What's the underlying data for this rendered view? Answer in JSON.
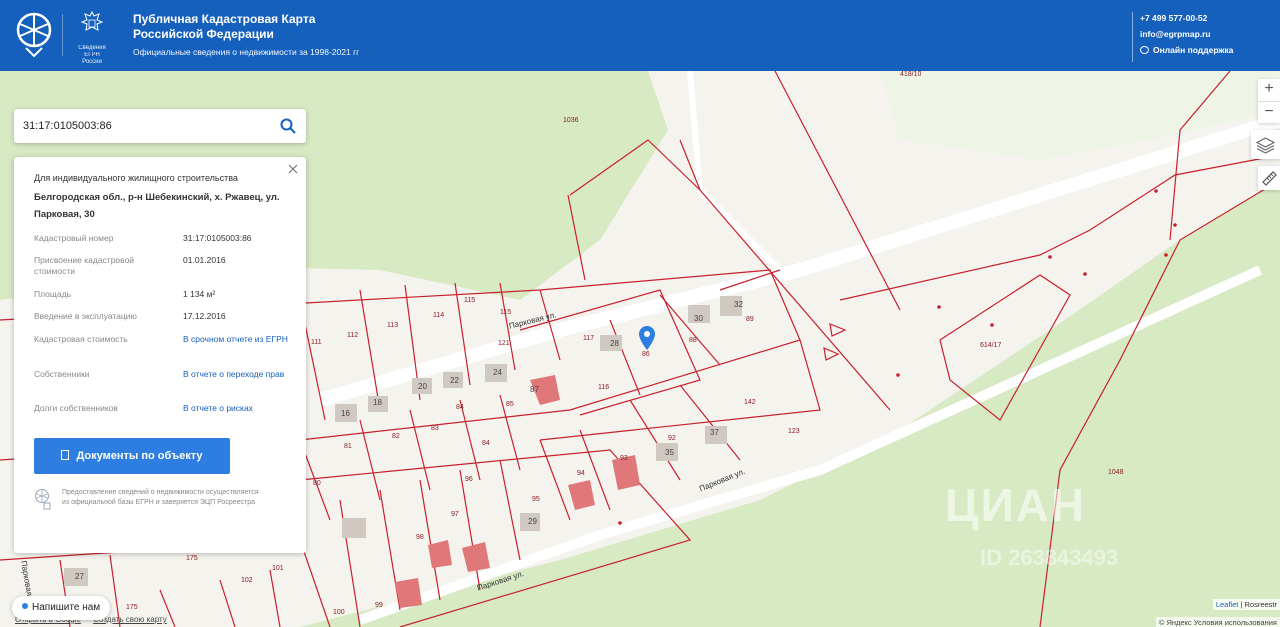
{
  "header": {
    "title_line1": "Публичная Кадастровая Карта",
    "title_line2": "Российской Федерации",
    "subtitle": "Официальные сведения о недвижимости за 1998-2021 гг",
    "emblem_line1": "Сведения",
    "emblem_line2": "ЕГРН России",
    "phone": "+7 499 577-00-52",
    "email": "info@egrpmap.ru",
    "support": "Онлайн поддержка"
  },
  "search": {
    "value": "31:17:0105003:86"
  },
  "panel": {
    "type": "Для индивидуального жилищного строительства",
    "address": "Белгородская обл., р-н Шебекинский, х. Ржавец, ул. Парковая, 30",
    "properties": [
      {
        "key": "Кадастровый номер",
        "value": "31:17:0105003:86",
        "link": false
      },
      {
        "key": "Присвоение кадастровой стоимости",
        "value": "01.01.2016",
        "link": false
      },
      {
        "key": "Площадь",
        "value": "1 134 м²",
        "link": false
      },
      {
        "key": "Введение в эксплуатацию",
        "value": "17.12.2016",
        "link": false
      },
      {
        "key": "Кадастровая стоимость",
        "value": "В срочном отчете из ЕГРН",
        "link": true
      },
      {
        "key": "Собственники",
        "value": "В отчете о переходе прав",
        "link": true
      },
      {
        "key": "Долги собственников",
        "value": "В отчете о рисках",
        "link": true
      }
    ],
    "docs_button": "Документы по объекту",
    "note": "Предоставление сведений о недвижимости осуществляется из официальной базы ЕГРН и заверяется ЭЦП Росреестра"
  },
  "map": {
    "street_labels": [
      "Парковая ул.",
      "Парковая ул.",
      "Парковая ул.",
      "Парковая ул."
    ],
    "parcel_numbers": [
      "1036",
      "418/10",
      "112",
      "113",
      "114",
      "115",
      "115",
      "111",
      "117",
      "121",
      "116",
      "86",
      "88",
      "89",
      "142",
      "123",
      "84",
      "85",
      "84",
      "83",
      "82",
      "81",
      "80",
      "92",
      "93",
      "94",
      "95",
      "96",
      "97",
      "98",
      "99",
      "100",
      "101",
      "102",
      "175",
      "175",
      "614/17",
      "1048"
    ],
    "house_numbers": [
      "30",
      "32",
      "28",
      "20",
      "22",
      "24",
      "16",
      "18",
      "87",
      "35",
      "37",
      "29",
      "27"
    ],
    "zoom_in": "+",
    "zoom_out": "−"
  },
  "watermark": {
    "brand": "ЦИАН",
    "id": "ID 263843493"
  },
  "bottom": {
    "chat": "Напишите нам",
    "link1": "Открыть в Google",
    "link2": "Создать свою карту",
    "leaflet": "Leaflet",
    "rosreestr": "Rosreestr",
    "yandex": "© Яндекс Условия использования"
  },
  "colors": {
    "header_bg": "#1560bd",
    "button": "#2d7ee0",
    "parcel_border": "#c8202d",
    "green_area": "#d7eac3",
    "land": "#f5f3ee"
  }
}
